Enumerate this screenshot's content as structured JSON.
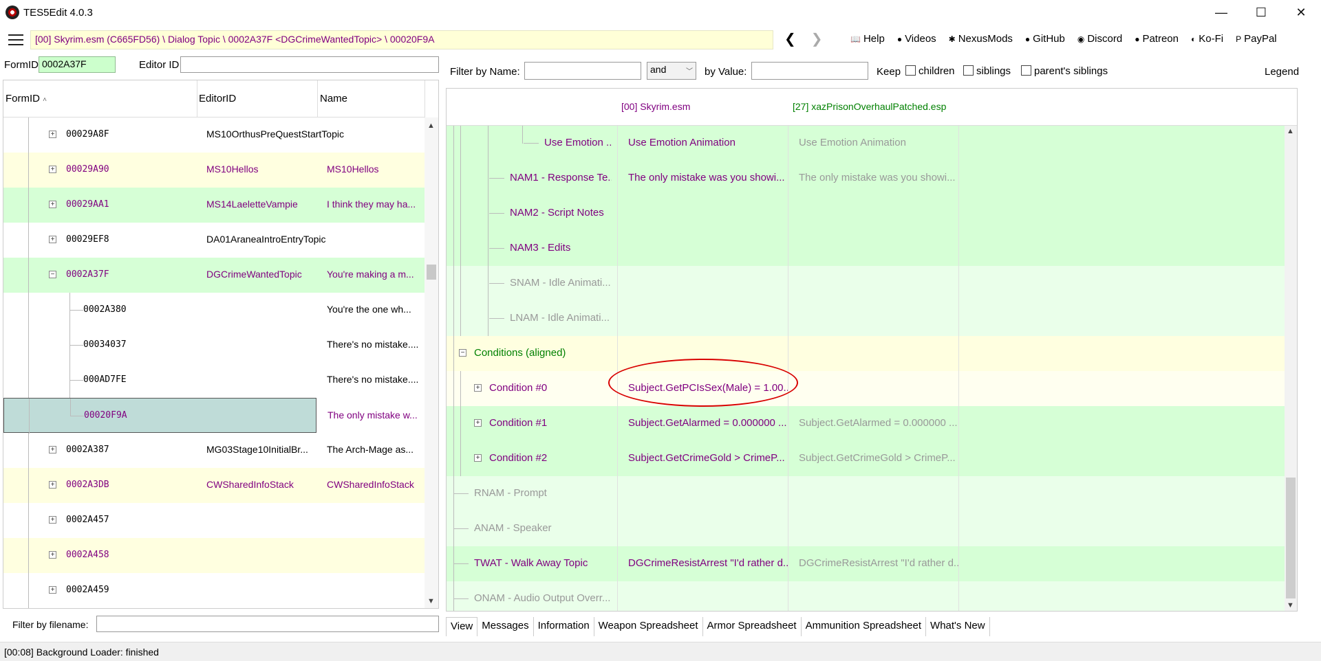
{
  "window": {
    "title": "TES5Edit 4.0.3",
    "minimize": "—",
    "maximize": "☐",
    "close": "✕"
  },
  "toolbar": {
    "path": "[00] Skyrim.esm (C665FD56) \\ Dialog Topic \\ 0002A37F <DGCrimeWantedTopic> \\ 00020F9A",
    "back": "❮",
    "forward": "❯",
    "links": [
      {
        "label": "Help",
        "icon": "📖"
      },
      {
        "label": "Videos",
        "icon": "●"
      },
      {
        "label": "NexusMods",
        "icon": "✱"
      },
      {
        "label": "GitHub",
        "icon": "●"
      },
      {
        "label": "Discord",
        "icon": "◉"
      },
      {
        "label": "Patreon",
        "icon": "●"
      },
      {
        "label": "Ko-Fi",
        "icon": "◐"
      },
      {
        "label": "PayPal",
        "icon": "P"
      }
    ]
  },
  "left": {
    "formid_label": "FormID",
    "formid_value": "0002A37F",
    "editorid_label": "Editor ID",
    "editorid_value": "",
    "columns": [
      "FormID",
      "EditorID",
      "Name"
    ],
    "sort_indicator": "˄",
    "rows": [
      {
        "formid": "00029A8F",
        "editorid": "MS10OrthusPreQuestStartTopic",
        "name": "",
        "bg": "white",
        "color": "black",
        "level": 1,
        "expander": "+"
      },
      {
        "formid": "00029A90",
        "editorid": "MS10Hellos",
        "name": "MS10Hellos",
        "bg": "yellow",
        "color": "purple",
        "level": 1,
        "expander": "+"
      },
      {
        "formid": "00029AA1",
        "editorid": "MS14LaeletteVampie",
        "name": "I think they may ha...",
        "bg": "green",
        "color": "purple",
        "level": 1,
        "expander": "+"
      },
      {
        "formid": "00029EF8",
        "editorid": "DA01AraneaIntroEntryTopic",
        "name": "",
        "bg": "white",
        "color": "black",
        "level": 1,
        "expander": "+"
      },
      {
        "formid": "0002A37F",
        "editorid": "DGCrimeWantedTopic",
        "name": "You're making a m...",
        "bg": "green",
        "color": "purple",
        "level": 1,
        "expander": "−"
      },
      {
        "formid": "0002A380",
        "editorid": "",
        "name": "You're the one wh...",
        "bg": "white",
        "color": "black",
        "level": 2,
        "expander": ""
      },
      {
        "formid": "00034037",
        "editorid": "",
        "name": "There's no mistake....",
        "bg": "white",
        "color": "black",
        "level": 2,
        "expander": ""
      },
      {
        "formid": "000AD7FE",
        "editorid": "",
        "name": "There's no mistake....",
        "bg": "white",
        "color": "black",
        "level": 2,
        "expander": ""
      },
      {
        "formid": "00020F9A",
        "editorid": "",
        "name": "The only mistake w...",
        "bg": "selected",
        "color": "purple",
        "level": 2,
        "expander": ""
      },
      {
        "formid": "0002A387",
        "editorid": "MG03Stage10InitialBr...",
        "name": "The Arch-Mage as...",
        "bg": "white",
        "color": "black",
        "level": 1,
        "expander": "+"
      },
      {
        "formid": "0002A3DB",
        "editorid": "CWSharedInfoStack",
        "name": "CWSharedInfoStack",
        "bg": "yellow",
        "color": "purple",
        "level": 1,
        "expander": "+"
      },
      {
        "formid": "0002A457",
        "editorid": "",
        "name": "",
        "bg": "white",
        "color": "black",
        "level": 1,
        "expander": "+"
      },
      {
        "formid": "0002A458",
        "editorid": "",
        "name": "",
        "bg": "yellow",
        "color": "purple",
        "level": 1,
        "expander": "+"
      },
      {
        "formid": "0002A459",
        "editorid": "",
        "name": "",
        "bg": "white",
        "color": "black",
        "level": 1,
        "expander": "+"
      }
    ],
    "filter_filename_label": "Filter by filename:",
    "filter_filename_value": ""
  },
  "right": {
    "filter_name_label": "Filter by Name:",
    "filter_name_value": "",
    "operator": "and",
    "by_value_label": "by Value:",
    "by_value_value": "",
    "keep_label": "Keep",
    "children_label": "children",
    "siblings_label": "siblings",
    "parents_siblings_label": "parent's siblings",
    "legend_label": "Legend",
    "col_headers": [
      "[00] Skyrim.esm",
      "[27] xazPrisonOverhaulPatched.esp"
    ],
    "rows": [
      {
        "label": "Use Emotion ...",
        "v1": "Use Emotion Animation",
        "v2": "Use Emotion Animation",
        "indent": 3,
        "bg": "green",
        "lcolor": "purple",
        "v1color": "purple",
        "v2color": "grey",
        "expander": ""
      },
      {
        "label": "NAM1 - Response Te...",
        "v1": "The only mistake was you showi...",
        "v2": "The only mistake was you showi...",
        "indent": 2,
        "bg": "green",
        "lcolor": "purple",
        "v1color": "purple",
        "v2color": "grey",
        "expander": ""
      },
      {
        "label": "NAM2 - Script Notes",
        "v1": "",
        "v2": "",
        "indent": 2,
        "bg": "green",
        "lcolor": "purple",
        "v1color": "purple",
        "v2color": "grey",
        "expander": ""
      },
      {
        "label": "NAM3 - Edits",
        "v1": "",
        "v2": "",
        "indent": 2,
        "bg": "green",
        "lcolor": "purple",
        "v1color": "purple",
        "v2color": "grey",
        "expander": ""
      },
      {
        "label": "SNAM - Idle Animati...",
        "v1": "",
        "v2": "",
        "indent": 2,
        "bg": "lightgreen",
        "lcolor": "grey",
        "v1color": "grey",
        "v2color": "grey",
        "expander": ""
      },
      {
        "label": "LNAM - Idle Animati...",
        "v1": "",
        "v2": "",
        "indent": 2,
        "bg": "lightgreen",
        "lcolor": "grey",
        "v1color": "grey",
        "v2color": "grey",
        "expander": ""
      },
      {
        "label": "Conditions (aligned)",
        "v1": "",
        "v2": "",
        "indent": 0,
        "bg": "yellow",
        "lcolor": "green",
        "v1color": "purple",
        "v2color": "grey",
        "expander": "−"
      },
      {
        "label": "Condition #0",
        "v1": "Subject.GetPCIsSex(Male) = 1.00...",
        "v2": "",
        "indent": 1,
        "bg": "lightyellow",
        "lcolor": "purple",
        "v1color": "purple",
        "v2color": "grey",
        "expander": "+"
      },
      {
        "label": "Condition #1",
        "v1": "Subject.GetAlarmed = 0.000000 ...",
        "v2": "Subject.GetAlarmed = 0.000000 ...",
        "indent": 1,
        "bg": "green",
        "lcolor": "purple",
        "v1color": "purple",
        "v2color": "grey",
        "expander": "+"
      },
      {
        "label": "Condition #2",
        "v1": "Subject.GetCrimeGold > CrimeP...",
        "v2": "Subject.GetCrimeGold > CrimeP...",
        "indent": 1,
        "bg": "green",
        "lcolor": "purple",
        "v1color": "purple",
        "v2color": "grey",
        "expander": "+"
      },
      {
        "label": "RNAM - Prompt",
        "v1": "",
        "v2": "",
        "indent": 0,
        "bg": "lightgreen",
        "lcolor": "grey",
        "v1color": "grey",
        "v2color": "grey",
        "expander": ""
      },
      {
        "label": "ANAM - Speaker",
        "v1": "",
        "v2": "",
        "indent": 0,
        "bg": "lightgreen",
        "lcolor": "grey",
        "v1color": "grey",
        "v2color": "grey",
        "expander": ""
      },
      {
        "label": "TWAT - Walk Away Topic",
        "v1": "DGCrimeResistArrest \"I'd rather d...",
        "v2": "DGCrimeResistArrest \"I'd rather d...",
        "indent": 0,
        "bg": "green",
        "lcolor": "purple",
        "v1color": "purple",
        "v2color": "grey",
        "expander": ""
      },
      {
        "label": "ONAM - Audio Output Overr...",
        "v1": "",
        "v2": "",
        "indent": 0,
        "bg": "lightgreen",
        "lcolor": "grey",
        "v1color": "grey",
        "v2color": "grey",
        "expander": ""
      }
    ],
    "tabs": [
      "View",
      "Messages",
      "Information",
      "Weapon Spreadsheet",
      "Armor Spreadsheet",
      "Ammunition Spreadsheet",
      "What's New"
    ],
    "active_tab": "View"
  },
  "status": {
    "text": "[00:08] Background Loader: finished"
  },
  "colors": {
    "yellow": "#ffffe0",
    "green": "#d6ffd6",
    "lightgreen": "#eaffea",
    "lightyellow": "#fffff0",
    "selected": "#bfdcd8",
    "purple": "#800080",
    "darkgreen": "#008000",
    "grey": "#999999",
    "highlight_circle": "#d80000"
  }
}
